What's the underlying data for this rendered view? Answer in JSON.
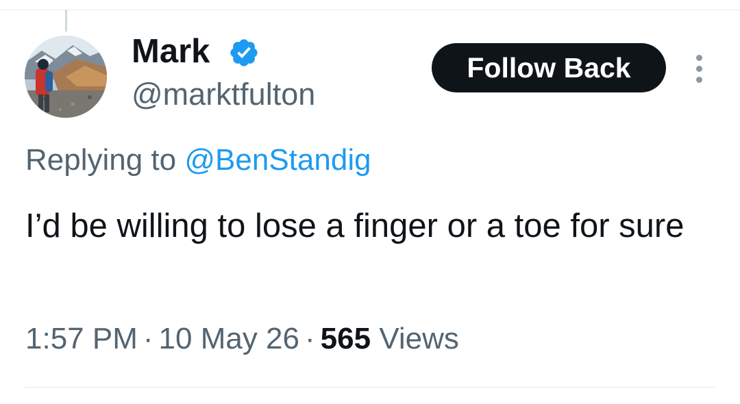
{
  "tweet": {
    "author": {
      "name": "Mark",
      "handle": "@marktfulton",
      "verified": true,
      "avatar_icon": "avatar-mountain-hiker"
    },
    "follow_button_label": "Follow Back",
    "more_icon": "vertical-ellipsis-icon",
    "reply": {
      "prefix": "Replying to",
      "target": "@BenStandig"
    },
    "text": "I’d be willing to lose a finger or a toe for sure",
    "meta": {
      "time": "1:57 PM",
      "separator": "·",
      "date": "10 May 26",
      "views_count": "565",
      "views_label": "Views"
    }
  },
  "colors": {
    "text_primary": "#0f1419",
    "text_secondary": "#536471",
    "link": "#1d9bf0",
    "verified": "#1d9bf0",
    "button_bg": "#0f1419",
    "button_text": "#ffffff",
    "divider": "#e7e9ea"
  }
}
